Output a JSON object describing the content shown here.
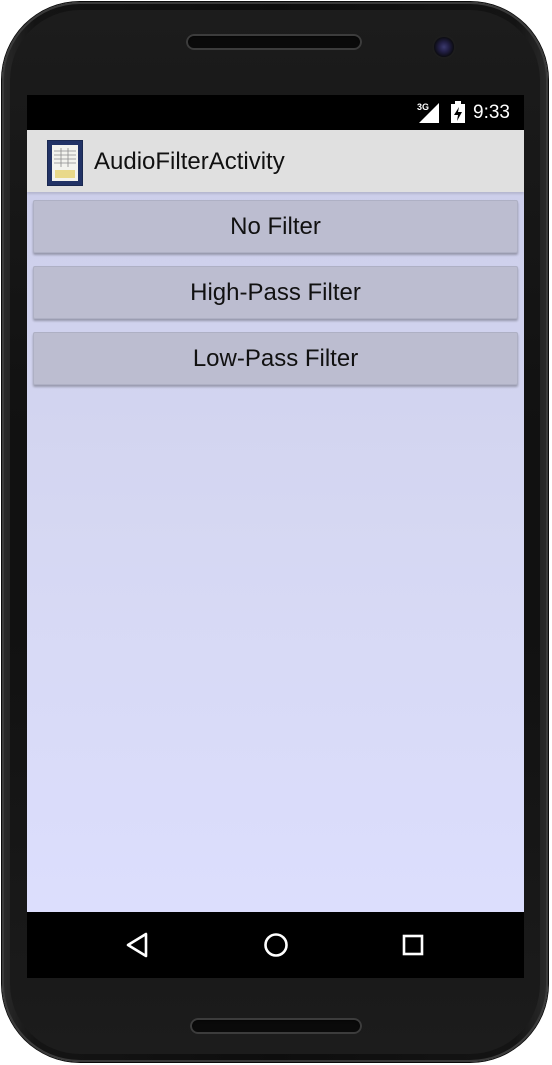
{
  "status_bar": {
    "network": "3G",
    "time": "9:33"
  },
  "action_bar": {
    "title": "AudioFilterActivity",
    "icon": "app-document-icon"
  },
  "buttons": [
    {
      "label": "No Filter"
    },
    {
      "label": "High-Pass Filter"
    },
    {
      "label": "Low-Pass Filter"
    }
  ],
  "nav_bar": {
    "back": "back-triangle-icon",
    "home": "home-circle-icon",
    "recents": "recents-square-icon"
  },
  "colors": {
    "content_background": "#d6d8f3",
    "button_background": "#bcbdd0",
    "action_bar": "#e0e0e0"
  }
}
